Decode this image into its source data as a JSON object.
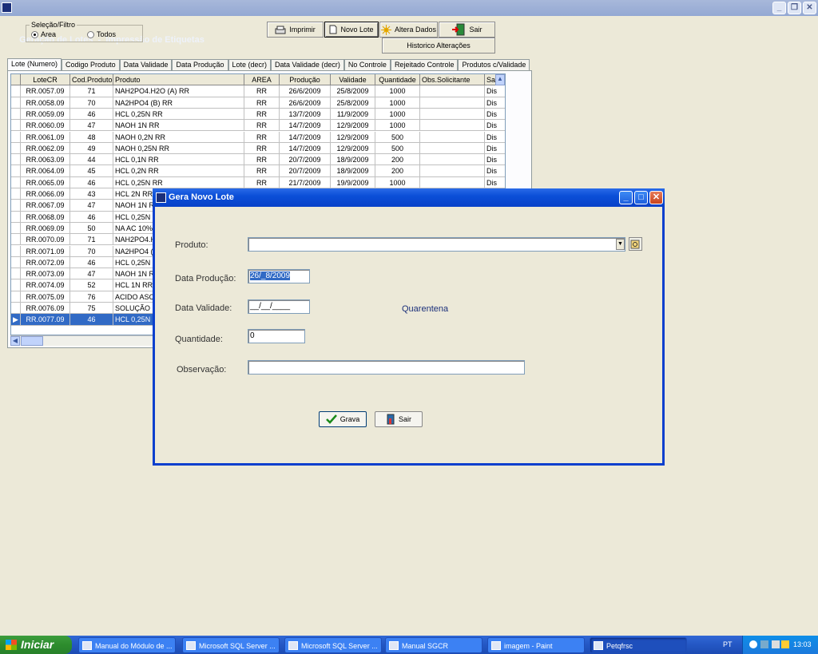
{
  "window": {
    "title": "Geração de Lotes  -  Impressão de Etiquetas"
  },
  "filter": {
    "legend": "Seleção/Filtro",
    "opt_area": "Area",
    "opt_todos": "Todos"
  },
  "toolbar": {
    "imprimir": "Imprimir",
    "novo_lote": "Novo Lote",
    "altera_dados": "Altera Dados",
    "sair": "Sair",
    "historico": "Historico Alterações"
  },
  "tabs": [
    "Lote (Numero)",
    "Codigo Produto",
    "Data Validade",
    "Data Produção",
    "Lote  (decr)",
    "Data Validade (decr)",
    "No Controle",
    "Rejeitado Controle",
    "Produtos c/Validade"
  ],
  "grid": {
    "headers": [
      "LoteCR",
      "Cod.Produto",
      "Produto",
      "AREA",
      "Produção",
      "Validade",
      "Quantidade",
      "Obs.Solicitante",
      "Sa"
    ],
    "rows": [
      [
        "RR.0057.09",
        "71",
        "NAH2PO4.H2O (A) RR",
        "RR",
        "26/6/2009",
        "25/8/2009",
        "1000",
        "",
        "Dis"
      ],
      [
        "RR.0058.09",
        "70",
        "NA2HPO4 (B) RR",
        "RR",
        "26/6/2009",
        "25/8/2009",
        "1000",
        "",
        "Dis"
      ],
      [
        "RR.0059.09",
        "46",
        "HCL 0,25N RR",
        "RR",
        "13/7/2009",
        "11/9/2009",
        "1000",
        "",
        "Dis"
      ],
      [
        "RR.0060.09",
        "47",
        "NAOH 1N RR",
        "RR",
        "14/7/2009",
        "12/9/2009",
        "1000",
        "",
        "Dis"
      ],
      [
        "RR.0061.09",
        "48",
        "NAOH 0,2N RR",
        "RR",
        "14/7/2009",
        "12/9/2009",
        "500",
        "",
        "Dis"
      ],
      [
        "RR.0062.09",
        "49",
        "NAOH 0,25N RR",
        "RR",
        "14/7/2009",
        "12/9/2009",
        "500",
        "",
        "Dis"
      ],
      [
        "RR.0063.09",
        "44",
        "HCL 0,1N  RR",
        "RR",
        "20/7/2009",
        "18/9/2009",
        "200",
        "",
        "Dis"
      ],
      [
        "RR.0064.09",
        "45",
        "HCL 0,2N  RR",
        "RR",
        "20/7/2009",
        "18/9/2009",
        "200",
        "",
        "Dis"
      ],
      [
        "RR.0065.09",
        "46",
        "HCL 0,25N RR",
        "RR",
        "21/7/2009",
        "19/9/2009",
        "1000",
        "",
        "Dis"
      ],
      [
        "RR.0066.09",
        "43",
        "HCL 2N RR",
        "",
        "",
        "",
        "",
        "",
        ""
      ],
      [
        "RR.0067.09",
        "47",
        "NAOH 1N RR",
        "",
        "",
        "",
        "",
        "",
        ""
      ],
      [
        "RR.0068.09",
        "46",
        "HCL 0,25N R",
        "",
        "",
        "",
        "",
        "",
        ""
      ],
      [
        "RR.0069.09",
        "50",
        "NA AC 10%",
        "",
        "",
        "",
        "",
        "",
        ""
      ],
      [
        "RR.0070.09",
        "71",
        "NAH2PO4.H",
        "",
        "",
        "",
        "",
        "",
        ""
      ],
      [
        "RR.0071.09",
        "70",
        "NA2HPO4 (B",
        "",
        "",
        "",
        "",
        "",
        ""
      ],
      [
        "RR.0072.09",
        "46",
        "HCL 0,25N R",
        "",
        "",
        "",
        "",
        "",
        ""
      ],
      [
        "RR.0073.09",
        "47",
        "NAOH 1N RR",
        "",
        "",
        "",
        "",
        "",
        ""
      ],
      [
        "RR.0074.09",
        "52",
        "HCL 1N RR",
        "",
        "",
        "",
        "",
        "",
        ""
      ],
      [
        "RR.0075.09",
        "76",
        "ACIDO ASCI",
        "",
        "",
        "",
        "",
        "",
        ""
      ],
      [
        "RR.0076.09",
        "75",
        "SOLUÇÃO D",
        "",
        "",
        "",
        "",
        "",
        ""
      ],
      [
        "RR.0077.09",
        "46",
        "HCL 0,25N R",
        "",
        "",
        "",
        "",
        "",
        ""
      ]
    ]
  },
  "dialog": {
    "title": "Gera Novo Lote",
    "produto_label": "Produto:",
    "produto_value": "",
    "data_producao_label": "Data Produção:",
    "data_producao_value": "26/_8/2009",
    "data_validade_label": "Data Validade:",
    "data_validade_value": "__/__/____",
    "quarentena": "Quarentena",
    "quantidade_label": "Quantidade:",
    "quantidade_value": "0",
    "observacao_label": "Observação:",
    "observacao_value": "",
    "grava": "Grava",
    "sair": "Sair"
  },
  "taskbar": {
    "start": "Iniciar",
    "items": [
      "Manual do Módulo de ...",
      "Microsoft SQL Server ...",
      "Microsoft SQL Server ...",
      "Manual SGCR",
      "imagem - Paint",
      "Petqfrsc"
    ],
    "lang": "PT",
    "clock": "13:03"
  }
}
